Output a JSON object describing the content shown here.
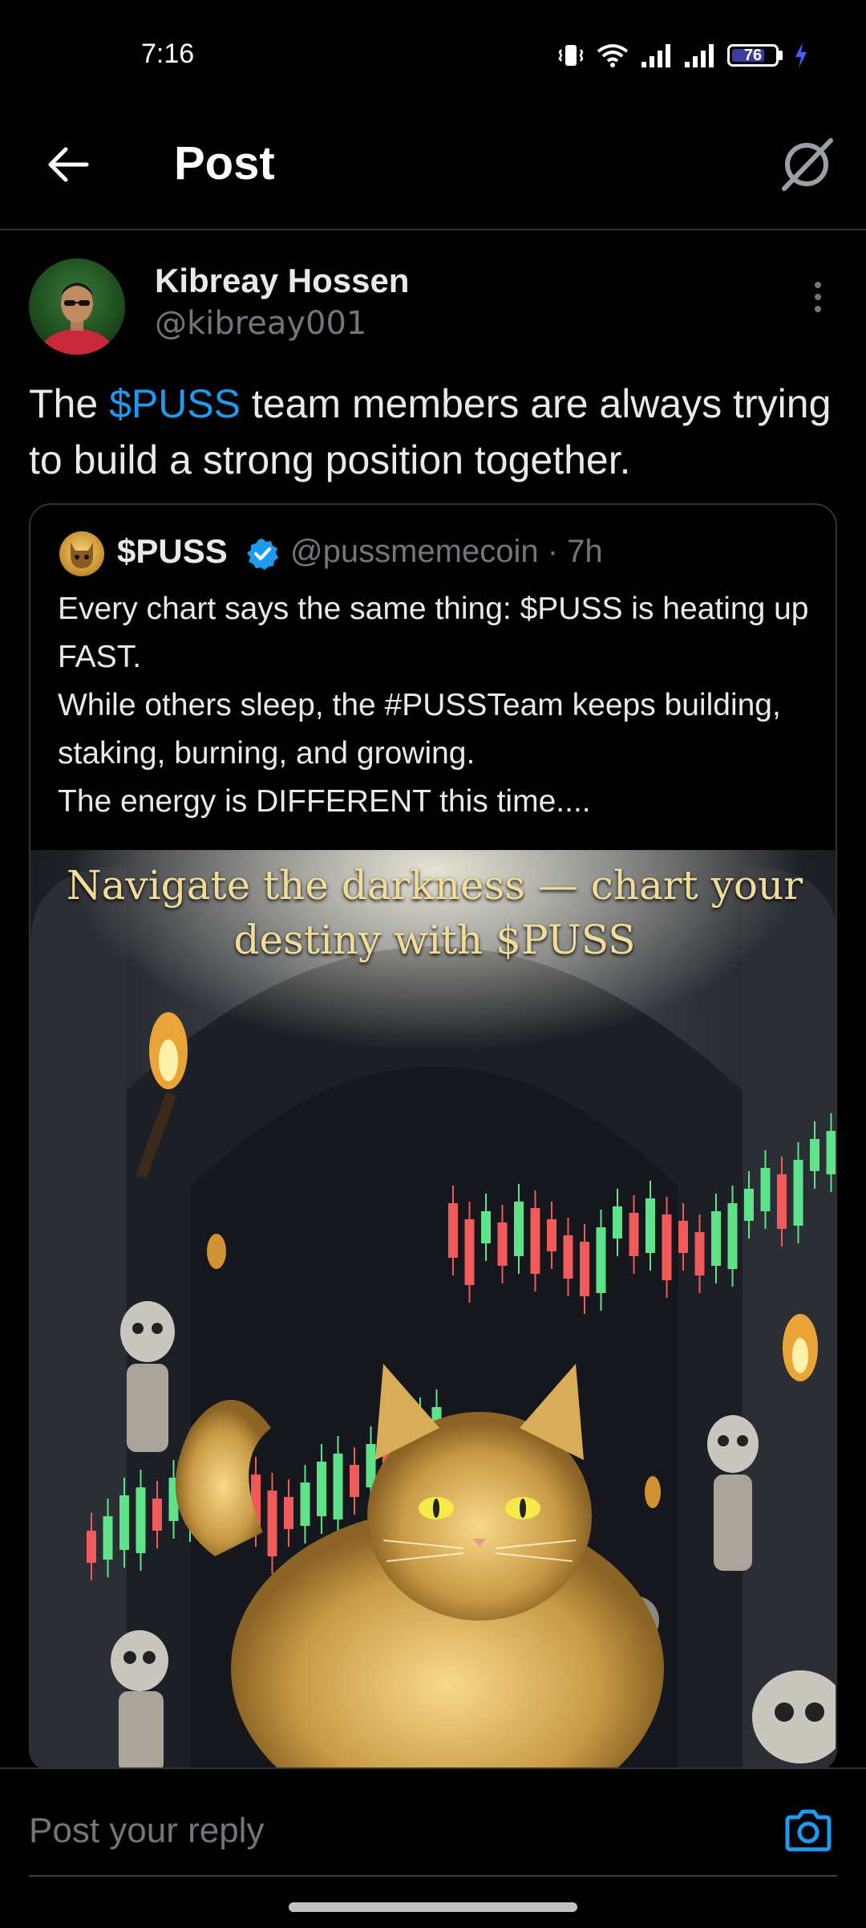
{
  "status_bar": {
    "time": "7:16",
    "battery": "76",
    "battery_level": 0.76,
    "icons": [
      "vibrate-icon",
      "wifi-icon",
      "signal-icon",
      "signal-icon",
      "battery-icon",
      "charging-icon"
    ]
  },
  "header": {
    "title": "Post",
    "back_icon": "back-arrow-icon",
    "grok_icon": "grok-icon"
  },
  "post": {
    "author_name": "Kibreay Hossen",
    "author_handle": "@kibreay001",
    "text_before": "The ",
    "mention": "$PUSS",
    "text_after": " team members are always trying to build a strong position together."
  },
  "quote": {
    "name": "$PUSS",
    "handle": "@pussmemecoin · 7h",
    "text": "Every chart says the same thing: $PUSS  is heating up FAST.\nWhile others sleep, the #PUSSTeam keeps building, staking, burning, and growing.\nThe energy is DIFFERENT this time....",
    "image_caption": "Navigate the darkness — chart your destiny with $PUSS"
  },
  "reply": {
    "placeholder": "Post your reply"
  },
  "colors": {
    "background": "#000000",
    "accent": "#1d9bf0",
    "secondary_text": "#71767b",
    "candle_up": "#5ee38a",
    "candle_down": "#f05a5a"
  }
}
